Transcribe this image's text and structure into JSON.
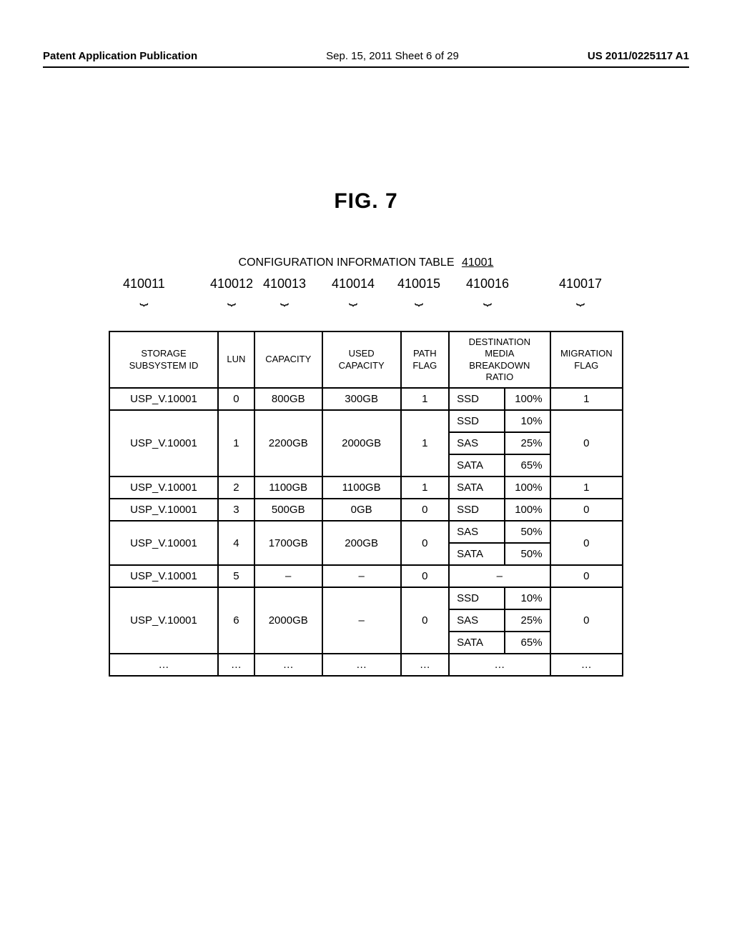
{
  "header": {
    "left": "Patent Application Publication",
    "center": "Sep. 15, 2011  Sheet 6 of 29",
    "right": "US 2011/0225117 A1"
  },
  "figure_title": "FIG. 7",
  "caption": {
    "text": "CONFIGURATION INFORMATION TABLE",
    "ref": "41001"
  },
  "col_refs": [
    "410011",
    "410012",
    "410013",
    "410014",
    "410015",
    "410016",
    "410017"
  ],
  "columns": {
    "storage": "STORAGE SUBSYSTEM ID",
    "lun": "LUN",
    "capacity": "CAPACITY",
    "used": "USED CAPACITY",
    "path": "PATH FLAG",
    "dest": "DESTINATION MEDIA BREAKDOWN RATIO",
    "migration": "MIGRATION FLAG"
  },
  "chart_data": {
    "type": "table",
    "rows": [
      {
        "storage": "USP_V.10001",
        "lun": "0",
        "capacity": "800GB",
        "used": "300GB",
        "path": "1",
        "media": [
          {
            "m": "SSD",
            "p": "100%"
          }
        ],
        "migration": "1"
      },
      {
        "storage": "USP_V.10001",
        "lun": "1",
        "capacity": "2200GB",
        "used": "2000GB",
        "path": "1",
        "media": [
          {
            "m": "SSD",
            "p": "10%"
          },
          {
            "m": "SAS",
            "p": "25%"
          },
          {
            "m": "SATA",
            "p": "65%"
          }
        ],
        "migration": "0"
      },
      {
        "storage": "USP_V.10001",
        "lun": "2",
        "capacity": "1100GB",
        "used": "1100GB",
        "path": "1",
        "media": [
          {
            "m": "SATA",
            "p": "100%"
          }
        ],
        "migration": "1"
      },
      {
        "storage": "USP_V.10001",
        "lun": "3",
        "capacity": "500GB",
        "used": "0GB",
        "path": "0",
        "media": [
          {
            "m": "SSD",
            "p": "100%"
          }
        ],
        "migration": "0"
      },
      {
        "storage": "USP_V.10001",
        "lun": "4",
        "capacity": "1700GB",
        "used": "200GB",
        "path": "0",
        "media": [
          {
            "m": "SAS",
            "p": "50%"
          },
          {
            "m": "SATA",
            "p": "50%"
          }
        ],
        "migration": "0"
      },
      {
        "storage": "USP_V.10001",
        "lun": "5",
        "capacity": "–",
        "used": "–",
        "path": "0",
        "media": [
          {
            "m": "–",
            "p": ""
          }
        ],
        "migration": "0"
      },
      {
        "storage": "USP_V.10001",
        "lun": "6",
        "capacity": "2000GB",
        "used": "–",
        "path": "0",
        "media": [
          {
            "m": "SSD",
            "p": "10%"
          },
          {
            "m": "SAS",
            "p": "25%"
          },
          {
            "m": "SATA",
            "p": "65%"
          }
        ],
        "migration": "0"
      },
      {
        "storage": "…",
        "lun": "…",
        "capacity": "…",
        "used": "…",
        "path": "…",
        "media": [
          {
            "m": "…",
            "p": ""
          }
        ],
        "migration": "…"
      }
    ]
  }
}
